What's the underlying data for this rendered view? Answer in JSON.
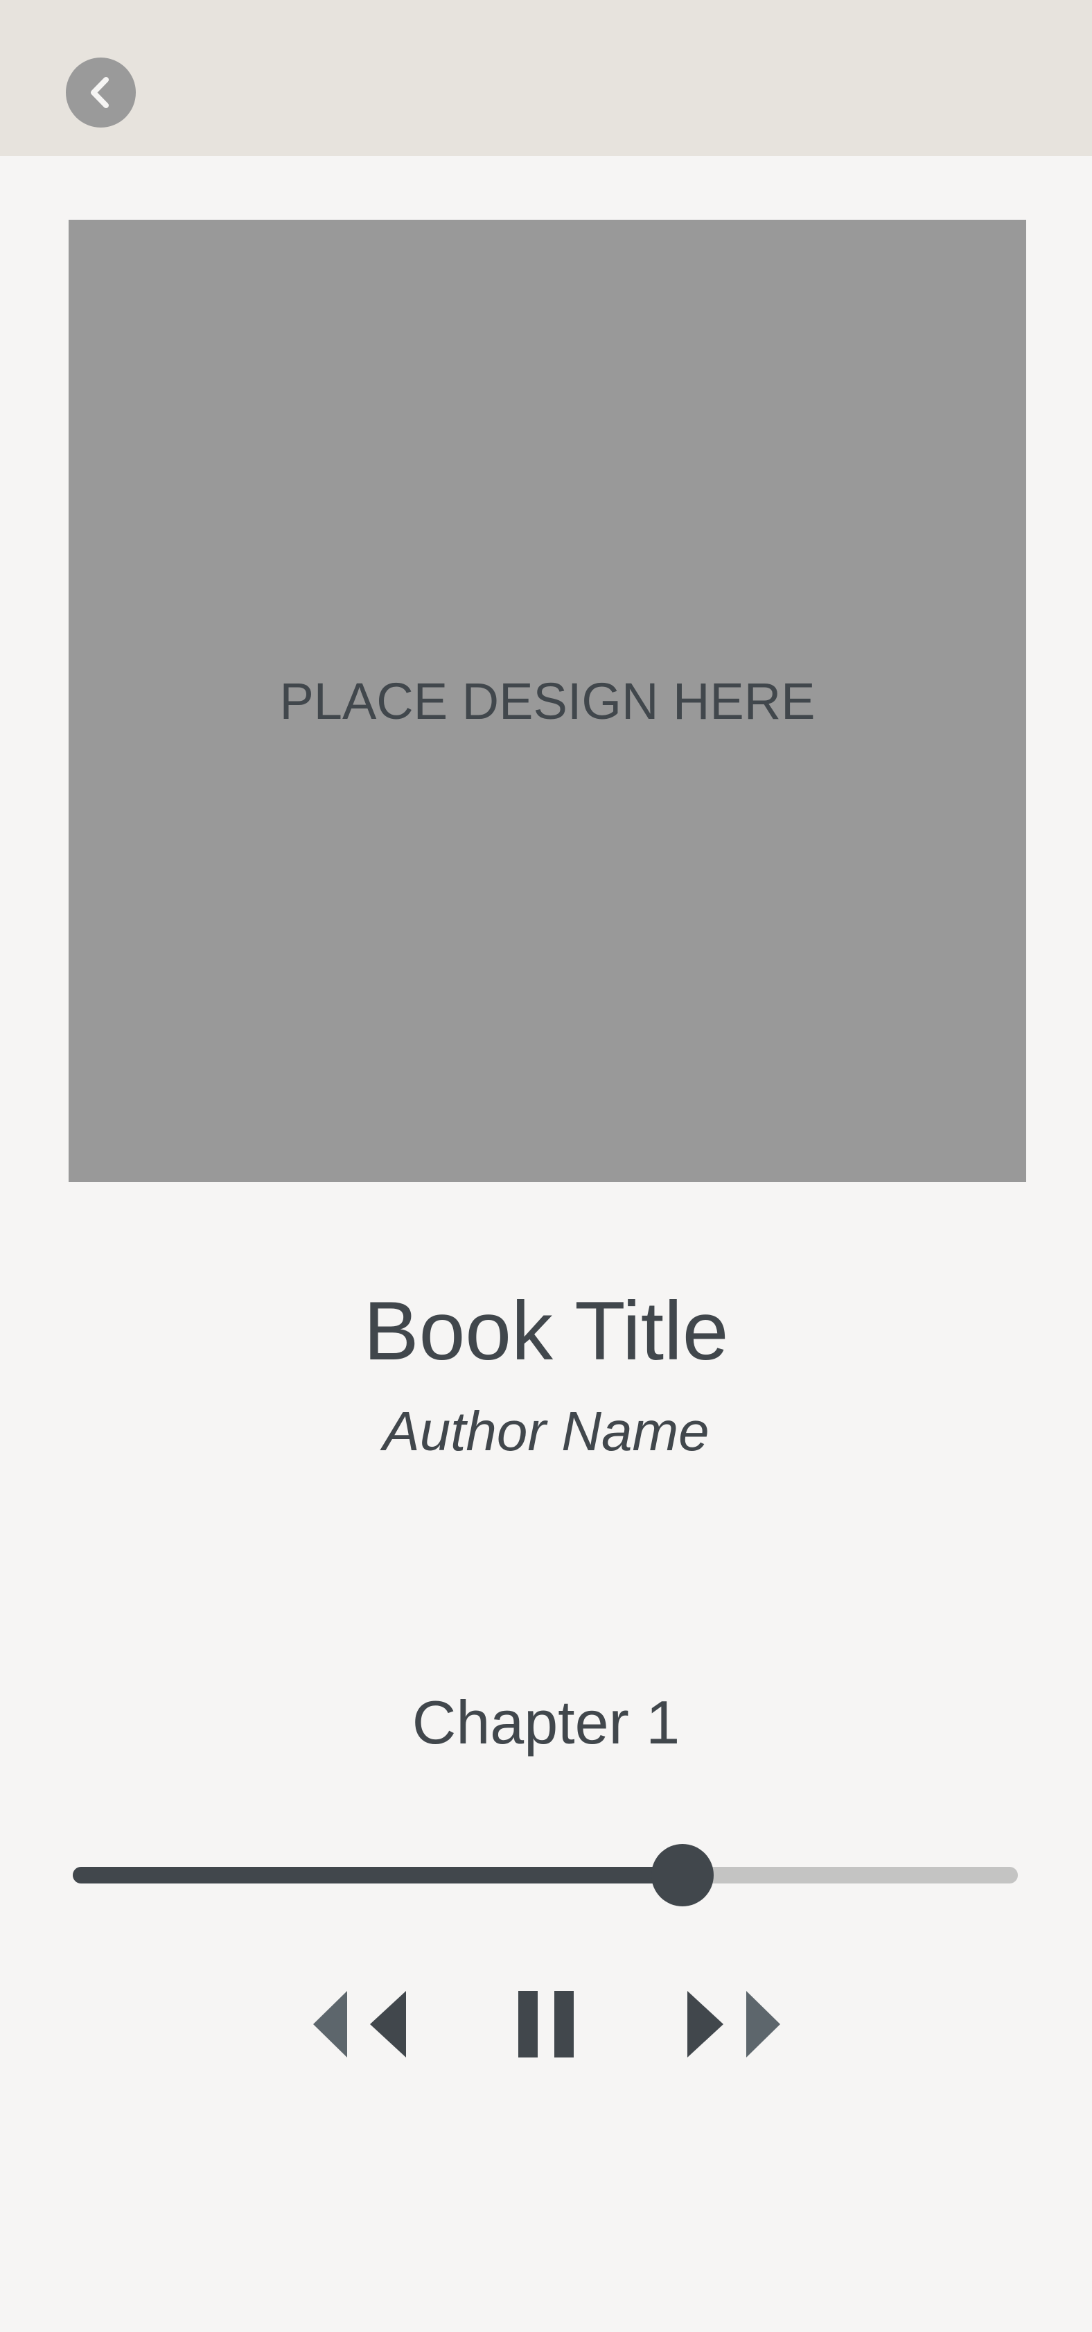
{
  "header": {
    "back_icon": "chevron-left-icon",
    "back_button_color": "#9a9a9a"
  },
  "cover": {
    "placeholder_text": "PLACE DESIGN HERE",
    "background": "#999999"
  },
  "book": {
    "title": "Book Title",
    "author": "Author Name"
  },
  "player": {
    "chapter": "Chapter 1",
    "progress": 0.645,
    "controls": {
      "rewind_icon": "rewind-icon",
      "pause_icon": "pause-icon",
      "fast_forward_icon": "fast-forward-icon"
    }
  },
  "colors": {
    "header_background": "#e7e3dd",
    "page_background": "#f6f5f4",
    "text": "#41474c",
    "track_unfilled": "#c4c4c3"
  }
}
